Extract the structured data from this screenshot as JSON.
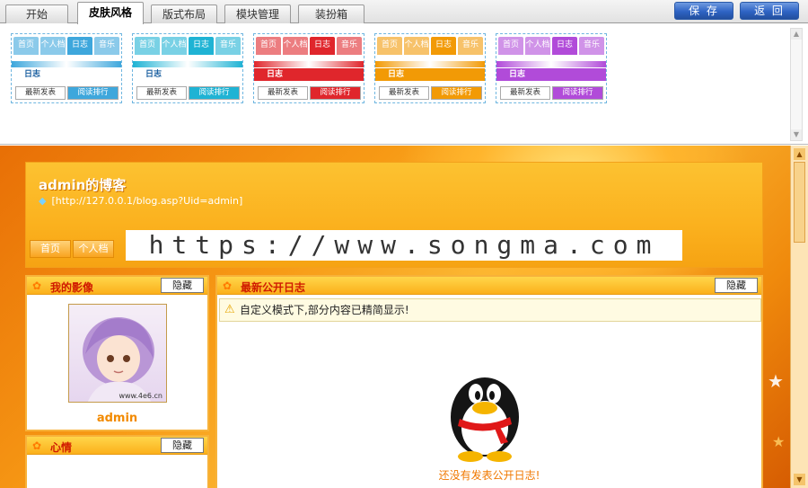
{
  "tabs": [
    {
      "label": "开始",
      "active": false
    },
    {
      "label": "皮肤风格",
      "active": true
    },
    {
      "label": "版式布局",
      "active": false
    },
    {
      "label": "模块管理",
      "active": false
    },
    {
      "label": "装扮箱",
      "active": false
    }
  ],
  "actions": {
    "save_label": "保 存",
    "back_label": "返 回"
  },
  "skins": [
    {
      "nav": [
        "首页",
        "个人档",
        "日志",
        "音乐"
      ],
      "title": "日志",
      "btn1": "最新发表",
      "btn2": "阅读排行",
      "accent": "#3ea7dc"
    },
    {
      "nav": [
        "首页",
        "个人档",
        "日志",
        "音乐"
      ],
      "title": "日志",
      "btn1": "最新发表",
      "btn2": "阅读排行",
      "accent": "#1fb3d4"
    },
    {
      "nav": [
        "首页",
        "个人档",
        "日志",
        "音乐"
      ],
      "title": "日志",
      "btn1": "最新发表",
      "btn2": "阅读排行",
      "accent": "#e0262c"
    },
    {
      "nav": [
        "首页",
        "个人档",
        "日志",
        "音乐"
      ],
      "title": "日志",
      "btn1": "最新发表",
      "btn2": "阅读排行",
      "accent": "#f29a06"
    },
    {
      "nav": [
        "首页",
        "个人档",
        "日志",
        "音乐"
      ],
      "title": "日志",
      "btn1": "最新发表",
      "btn2": "阅读排行",
      "accent": "#b14bd9"
    }
  ],
  "blog": {
    "title": "admin的博客",
    "url": "[http://127.0.0.1/blog.asp?Uid=admin]",
    "nav": [
      "首页",
      "个人档"
    ],
    "watermark": "https://www.songma.com"
  },
  "panels": {
    "image": {
      "title": "我的影像",
      "hide": "隐藏",
      "username": "admin",
      "avatar_caption": "www.4e6.cn"
    },
    "mood": {
      "title": "心情",
      "hide": "隐藏"
    },
    "logs": {
      "title": "最新公开日志",
      "hide": "隐藏",
      "notice": "自定义模式下,部分内容已精简显示!",
      "empty": "还没有发表公开日志!"
    }
  },
  "colors": {
    "primary_button": "#2e63c4",
    "theme_orange": "#f79a15",
    "title_red": "#d01b00"
  }
}
